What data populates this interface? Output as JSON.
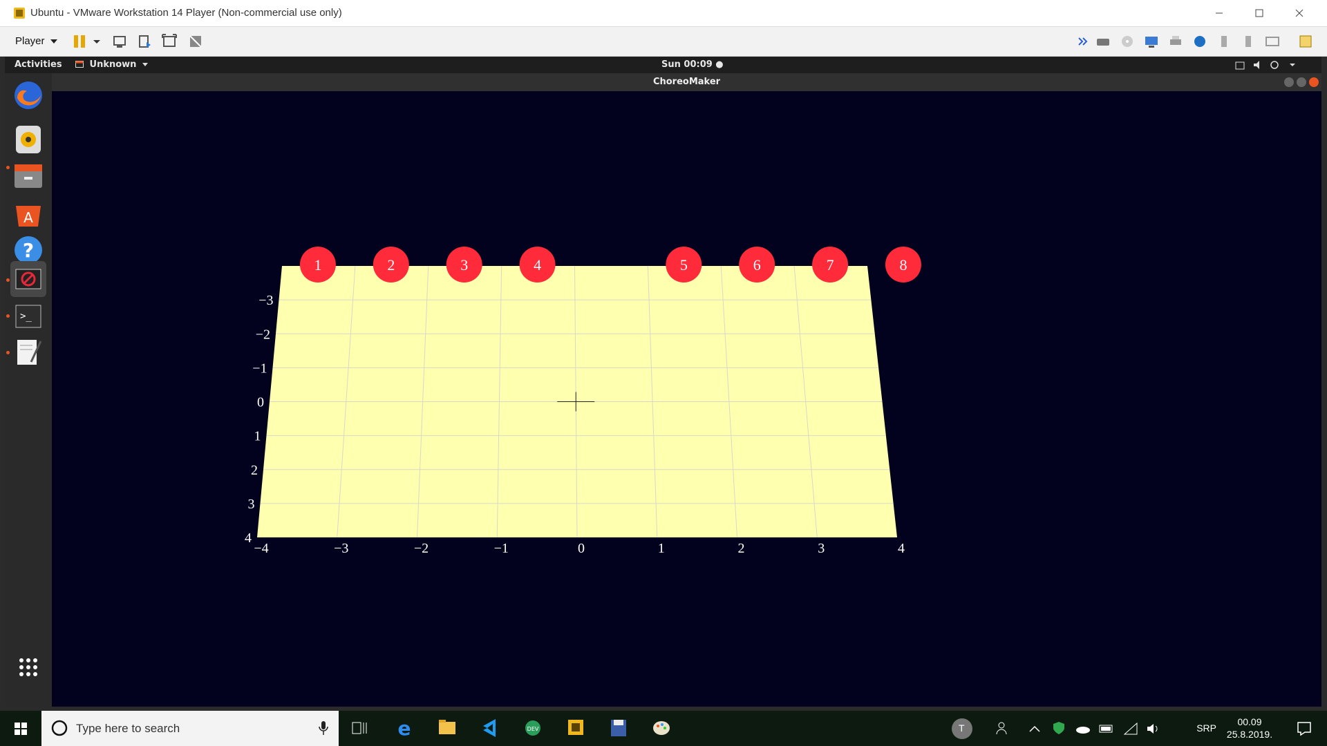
{
  "window": {
    "title": "Ubuntu - VMware Workstation 14 Player (Non-commercial use only)",
    "controls": [
      "minimize-icon",
      "maximize-icon",
      "close-icon"
    ]
  },
  "vm_toolbar": {
    "player_label": "Player"
  },
  "ubuntu_topbar": {
    "activities": "Activities",
    "app_menu": "Unknown",
    "clock": "Sun 00:09 ●"
  },
  "dock": {
    "items": [
      "firefox-icon",
      "rhythmbox-icon",
      "files-icon",
      "software-icon",
      "help-icon",
      "choreomaker-icon",
      "terminal-icon",
      "text-editor-icon"
    ],
    "show_apps_icon": "grid-icon"
  },
  "app": {
    "title": "ChoreoMaker"
  },
  "stage": {
    "floor_color": "#ffffb0",
    "dancer_color": "#ff2a3a",
    "background_color": "#02021e",
    "y_ticks": [
      "−3",
      "−2",
      "−1",
      "0",
      "1",
      "2",
      "3",
      "4"
    ],
    "x_ticks": [
      "−4",
      "−3",
      "−2",
      "−1",
      "0",
      "1",
      "2",
      "3",
      "4"
    ],
    "dancers": [
      {
        "label": "1",
        "x": -3.5,
        "y": -4
      },
      {
        "label": "2",
        "x": -2.5,
        "y": -4
      },
      {
        "label": "3",
        "x": -1.5,
        "y": -4
      },
      {
        "label": "4",
        "x": -0.5,
        "y": -4
      },
      {
        "label": "5",
        "x": 1.5,
        "y": -4
      },
      {
        "label": "6",
        "x": 2.5,
        "y": -4
      },
      {
        "label": "7",
        "x": 3.5,
        "y": -4
      },
      {
        "label": "8",
        "x": 4.5,
        "y": -4
      }
    ]
  },
  "taskbar": {
    "search_placeholder": "Type here to search",
    "lang": "SRP",
    "time": "00.09",
    "date": "25.8.2019.",
    "user_initial": "T"
  }
}
